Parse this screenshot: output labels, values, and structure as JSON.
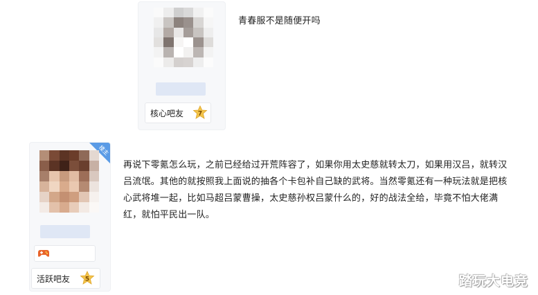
{
  "post1": {
    "badge_label": "核心吧友",
    "level": "7",
    "content": "青春服不是随便开吗"
  },
  "post2": {
    "ribbon_text": "楼主",
    "badge_label": "活跃吧友",
    "level": "5",
    "content": "再说下零氪怎么玩，之前已经给过开荒阵容了，如果你用太史慈就转太刀，如果用汉吕，就转汉吕流氓。其他的就按照我上面说的抽各个卡包补自己缺的武将。当然零氪还有一种玩法就是把核心武将堆一起，比如马超吕蒙曹操，太史慈孙权吕蒙什么的，好的战法全给，毕竟不怕大佬满红，就怕平民出一队。"
  },
  "watermark": "踏玩大电竞",
  "colors": {
    "star_fill": "#f3c44a",
    "star_text": "#7a4a00",
    "ribbon": "#5a9be6",
    "medal": "#e8632a"
  }
}
